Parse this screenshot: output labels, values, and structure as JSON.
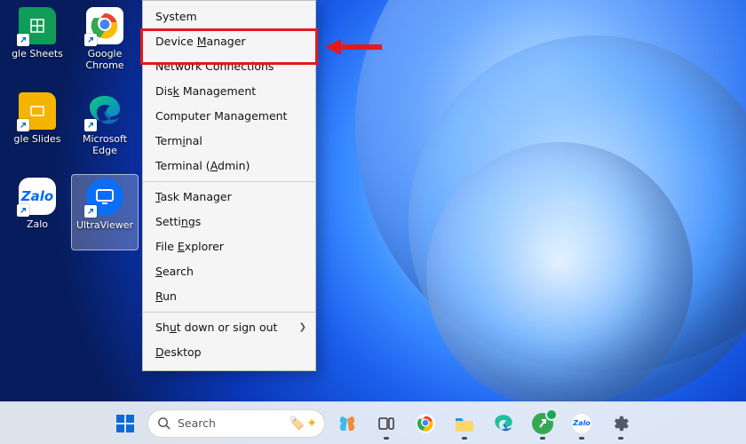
{
  "desktop": {
    "icons": [
      {
        "name": "google-sheets",
        "label": "gle Sheets"
      },
      {
        "name": "google-chrome",
        "label": "Google Chrome"
      },
      {
        "name": "google-slides",
        "label": "gle Slides"
      },
      {
        "name": "microsoft-edge",
        "label": "Microsoft Edge"
      },
      {
        "name": "zalo",
        "label": "Zalo"
      },
      {
        "name": "ultraviewer",
        "label": "UltraViewer"
      }
    ]
  },
  "context_menu": {
    "items": [
      {
        "id": "system",
        "label": "System",
        "mnemonic": null
      },
      {
        "id": "device-manager",
        "label": "Device Manager",
        "mnemonic": "M",
        "highlighted": true
      },
      {
        "id": "network-connections",
        "label": "Network Connections",
        "mnemonic": null
      },
      {
        "id": "disk-management",
        "label": "Disk Management",
        "mnemonic": "k"
      },
      {
        "id": "computer-management",
        "label": "Computer Management",
        "mnemonic": null
      },
      {
        "id": "terminal",
        "label": "Terminal",
        "mnemonic": "i"
      },
      {
        "id": "terminal-admin",
        "label": "Terminal (Admin)",
        "mnemonic": "A"
      },
      {
        "sep": true
      },
      {
        "id": "task-manager",
        "label": "Task Manager",
        "mnemonic": "T"
      },
      {
        "id": "settings",
        "label": "Settings",
        "mnemonic": "N"
      },
      {
        "id": "file-explorer",
        "label": "File Explorer",
        "mnemonic": "E"
      },
      {
        "id": "search",
        "label": "Search",
        "mnemonic": "S"
      },
      {
        "id": "run",
        "label": "Run",
        "mnemonic": "R"
      },
      {
        "sep": true
      },
      {
        "id": "shutdown",
        "label": "Shut down or sign out",
        "mnemonic": "U",
        "submenu": true
      },
      {
        "id": "desktop",
        "label": "Desktop",
        "mnemonic": "D"
      }
    ]
  },
  "taskbar": {
    "search_placeholder": "Search",
    "items": [
      {
        "id": "start",
        "name": "Start"
      },
      {
        "id": "search",
        "name": "Search"
      },
      {
        "id": "copilot",
        "name": "Copilot"
      },
      {
        "id": "task-view",
        "name": "Task view"
      },
      {
        "id": "chrome",
        "name": "Google Chrome"
      },
      {
        "id": "explorer",
        "name": "File Explorer"
      },
      {
        "id": "edge",
        "name": "Microsoft Edge"
      },
      {
        "id": "coccoc",
        "name": "Browser"
      },
      {
        "id": "zalo",
        "name": "Zalo"
      },
      {
        "id": "settings",
        "name": "Settings"
      }
    ]
  },
  "annotation": {
    "target": "device-manager",
    "color": "#e21a1a"
  }
}
